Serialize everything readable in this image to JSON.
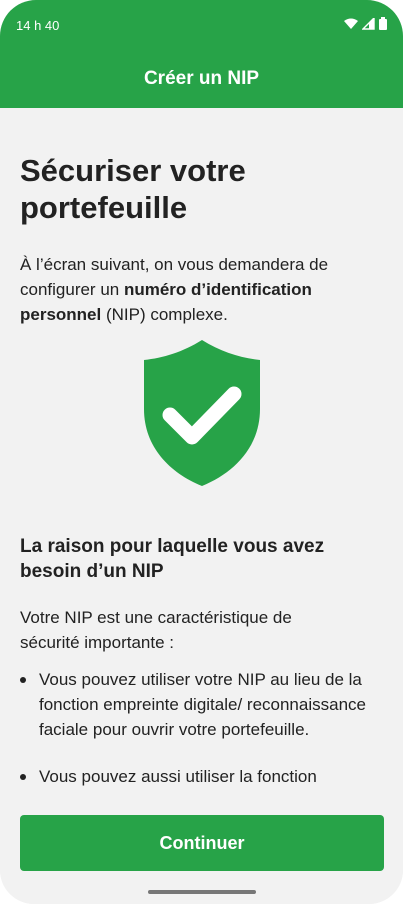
{
  "status_bar": {
    "time": "14 h 40",
    "icons": [
      "wifi-icon",
      "signal-icon",
      "battery-icon"
    ]
  },
  "app_bar": {
    "title": "Créer un NIP"
  },
  "content": {
    "headline": "Sécuriser votre portefeuille",
    "intro_before": "À l’écran suivant, on vous demandera de configurer un ",
    "intro_bold": "numéro d’identification personnel",
    "intro_after": " (NIP) complexe.",
    "illustration": "shield-check-icon",
    "reason_title": "La raison pour laquelle vous avez besoin d’un NIP",
    "reason_text": "Votre NIP est une caractéristique de sécurité importante :",
    "bullets": [
      "Vous pouvez utiliser votre NIP au lieu de la fonction empreinte digitale/ reconnaissance faciale pour ouvrir votre portefeuille.",
      "Vous pouvez aussi utiliser la fonction"
    ]
  },
  "footer": {
    "button": "Continuer"
  },
  "colors": {
    "primary": "#27A348",
    "text": "#222222",
    "background": "#F2F2F2"
  }
}
